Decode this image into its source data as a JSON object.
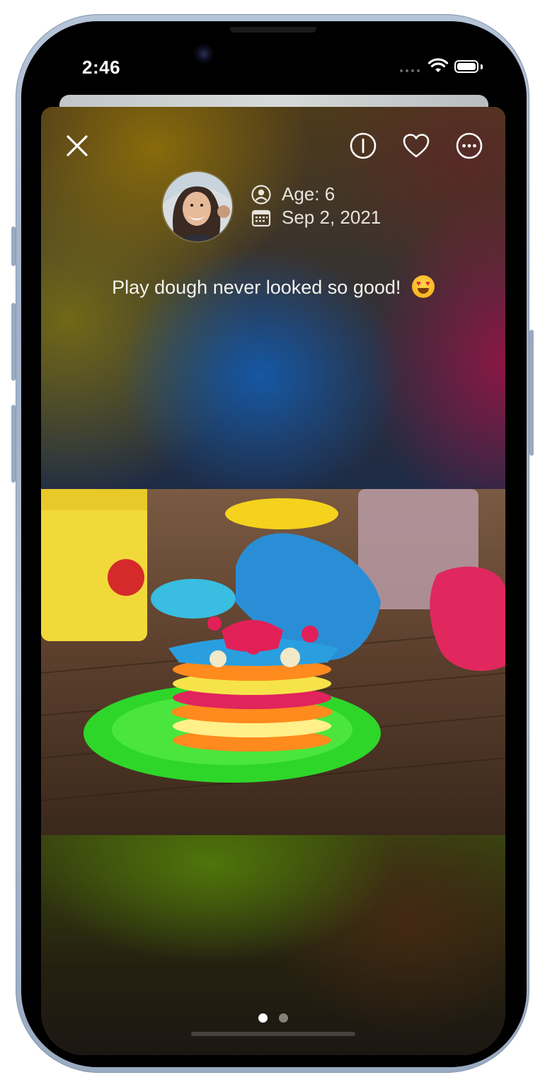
{
  "status_bar": {
    "time": "2:46"
  },
  "toolbar": {
    "close_icon": "close-icon",
    "info_icon": "info-icon",
    "favorite_icon": "heart-icon",
    "more_icon": "more-options-icon"
  },
  "post": {
    "age_label": "Age: 6",
    "date_label": "Sep 2, 2021",
    "caption": "Play dough never looked so good!",
    "caption_emoji": "heart-eyes-emoji"
  },
  "pagination": {
    "current_page": 1,
    "total_pages": 2
  },
  "colors": {
    "text_primary": "#ffffff",
    "device_frame": "#b6c4d8",
    "pagination_active": "#ffffff",
    "pagination_inactive": "#7f7f7f"
  }
}
